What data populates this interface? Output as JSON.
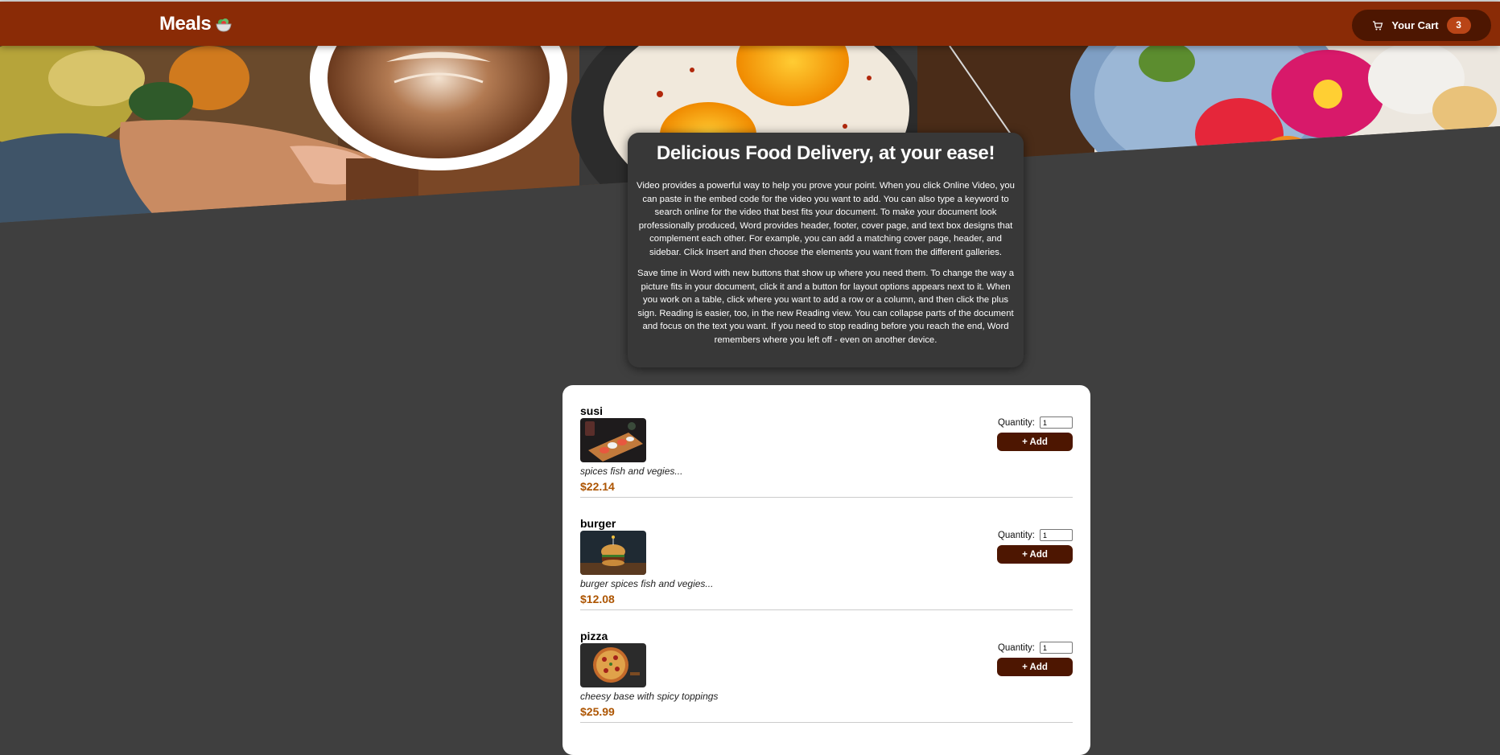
{
  "header": {
    "logo_text": "Meals",
    "logo_icon": "salad-bowl-icon",
    "cart_label": "Your Cart",
    "cart_icon": "cart-icon",
    "cart_count": "3"
  },
  "summary": {
    "title": "Delicious Food Delivery, at your ease!",
    "paragraph_1": "Video provides a powerful way to help you prove your point. When you click Online Video, you can paste in the embed code for the video you want to add. You can also type a keyword to search online for the video that best fits your document. To make your document look professionally produced, Word provides header, footer, cover page, and text box designs that complement each other. For example, you can add a matching cover page, header, and sidebar. Click Insert and then choose the elements you want from the different galleries.",
    "paragraph_2": "Save time in Word with new buttons that show up where you need them. To change the way a picture fits in your document, click it and a button for layout options appears next to it. When you work on a table, click where you want to add a row or a column, and then click the plus sign. Reading is easier, too, in the new Reading view. You can collapse parts of the document and focus on the text you want. If you need to stop reading before you reach the end, Word remembers where you left off - even on another device."
  },
  "meals": [
    {
      "name": "susi",
      "description": "spices fish and vegies...",
      "price": "$22.14",
      "quantity_label": "Quantity:",
      "quantity_value": "1",
      "add_label": "+ Add"
    },
    {
      "name": "burger",
      "description": "burger spices fish and vegies...",
      "price": "$12.08",
      "quantity_label": "Quantity:",
      "quantity_value": "1",
      "add_label": "+ Add"
    },
    {
      "name": "pizza",
      "description": "cheesy base with spicy toppings",
      "price": "$25.99",
      "quantity_label": "Quantity:",
      "quantity_value": "1",
      "add_label": "+ Add"
    }
  ],
  "colors": {
    "header_bg": "#8a2b06",
    "button_bg": "#4d1601",
    "badge_bg": "#b94517",
    "price": "#ad5502",
    "page_bg": "#3f3f3f"
  }
}
